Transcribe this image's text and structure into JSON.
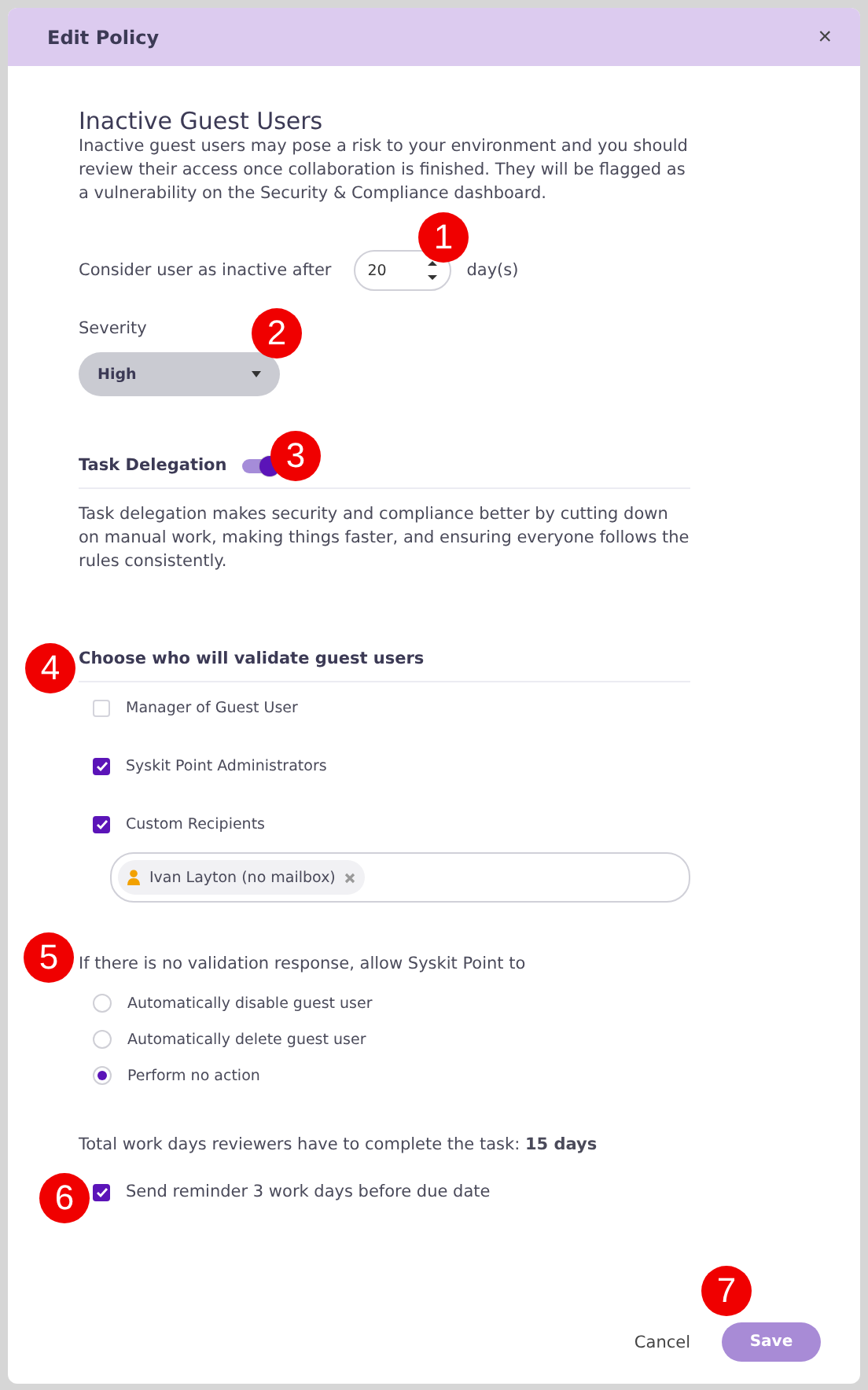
{
  "dialog": {
    "title": "Edit Policy",
    "close": "×"
  },
  "policy": {
    "heading": "Inactive Guest Users",
    "description": "Inactive guest users may pose a risk to your environment and you should review their access once collaboration is finished. They will be flagged as a vulnerability on the Security & Compliance dashboard.",
    "inactive_label": "Consider user as inactive after",
    "inactive_value": "20",
    "inactive_unit": "day(s)",
    "callout": "1"
  },
  "severity": {
    "label": "Severity",
    "value": "High",
    "callout": "2"
  },
  "task_delegation": {
    "label": "Task Delegation",
    "on": true,
    "description": "Task delegation makes security and compliance better by cutting down on manual work, making things faster, and ensuring everyone follows the rules consistently.",
    "callout": "3"
  },
  "validators": {
    "heading": "Choose who will validate guest users",
    "callout": "4",
    "options": [
      {
        "label": "Manager of Guest User",
        "checked": false
      },
      {
        "label": "Syskit Point Administrators",
        "checked": true
      },
      {
        "label": "Custom Recipients",
        "checked": true
      }
    ],
    "recipients": [
      {
        "name": "Ivan Layton (no mailbox)"
      }
    ]
  },
  "fallback": {
    "label": "If there is no validation response, allow Syskit Point to",
    "callout": "5",
    "options": [
      {
        "label": "Automatically disable guest user",
        "selected": false
      },
      {
        "label": "Automatically delete guest user",
        "selected": false
      },
      {
        "label": "Perform no action",
        "selected": true
      }
    ]
  },
  "total": "Total work days reviewers have to complete the task: **15 days**",
  "reminder": {
    "label": "Send reminder 3 work days before due date",
    "checked": true,
    "callout": "6"
  },
  "footer": {
    "cancel": "Cancel",
    "save": "Save",
    "save_disabled": true,
    "callout": "7"
  }
}
